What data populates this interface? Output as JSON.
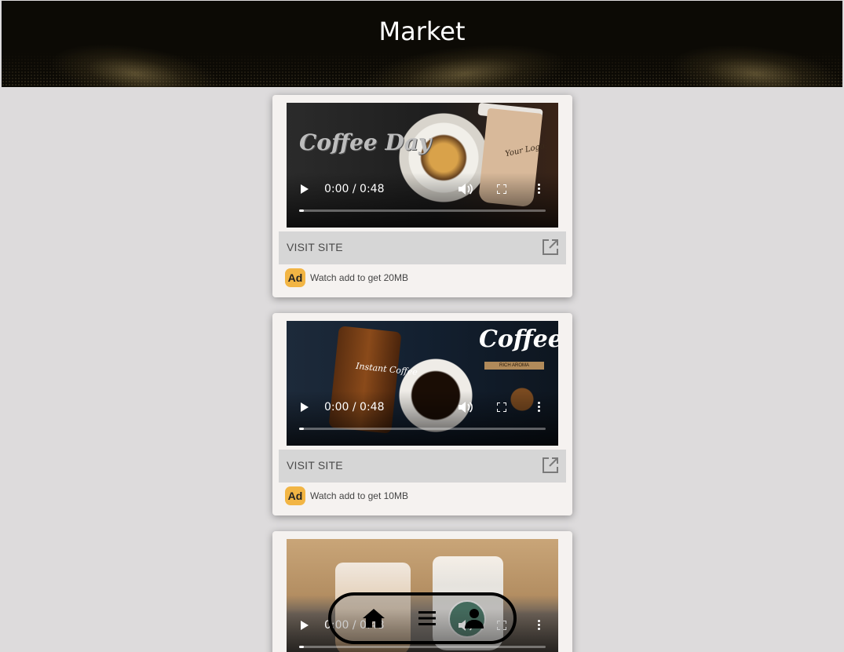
{
  "header": {
    "title": "Market"
  },
  "ads": [
    {
      "thumbnail_text": "Coffee Day",
      "thumbnail_logo": "Your Logo",
      "time": "0:00 / 0:48",
      "visit_label": "VISIT SITE",
      "badge": "Ad",
      "reward_text": "Watch add to get 20MB"
    },
    {
      "thumbnail_title": "Coffee",
      "thumbnail_jar": "Instant Coffee",
      "thumbnail_tagline": "RICH AROMA",
      "time": "0:00 / 0:48",
      "visit_label": "VISIT SITE",
      "badge": "Ad",
      "reward_text": "Watch add to get 10MB"
    },
    {
      "time": "0:00 / 0:48"
    }
  ],
  "bottom_nav": {
    "items": [
      {
        "icon": "home-icon"
      },
      {
        "icon": "menu-icon"
      },
      {
        "icon": "profile-icon"
      }
    ]
  },
  "colors": {
    "header_bg": "#0c0a05",
    "page_bg": "#dddbdc",
    "card_bg": "#f5f2f0",
    "visit_bg": "#d6d6d6",
    "ad_badge": "#f2b544"
  }
}
